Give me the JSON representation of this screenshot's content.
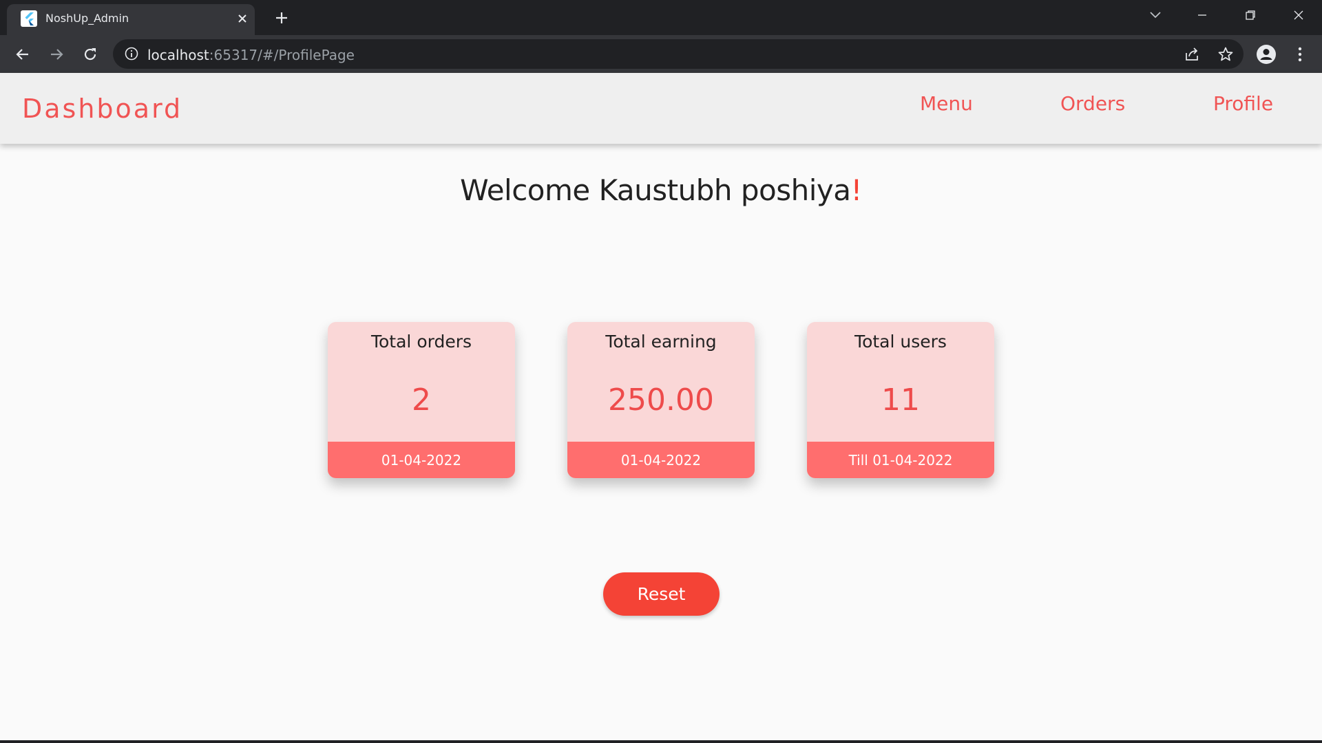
{
  "browser": {
    "tab_title": "NoshUp_Admin",
    "url_host": "localhost",
    "url_path": ":65317/#/ProfilePage"
  },
  "app": {
    "brand": "Dashboard",
    "nav": {
      "menu": "Menu",
      "orders": "Orders",
      "profile": "Profile"
    },
    "welcome_text": "Welcome Kaustubh poshiya",
    "welcome_suffix": "!",
    "cards": [
      {
        "title": "Total orders",
        "value": "2",
        "footer": "01-04-2022"
      },
      {
        "title": "Total earning",
        "value": "250.00",
        "footer": "01-04-2022"
      },
      {
        "title": "Total users",
        "value": "11",
        "footer": "Till 01-04-2022"
      }
    ],
    "reset_label": "Reset"
  },
  "colors": {
    "accent": "#f05454",
    "card_bg": "#fad7d7",
    "card_footer": "#ff6e6e",
    "button": "#f44336"
  },
  "icons": [
    "flutter-favicon-icon",
    "close-icon",
    "plus-icon",
    "chevron-down-icon",
    "minimize-icon",
    "restore-icon",
    "window-close-icon",
    "back-arrow-icon",
    "forward-arrow-icon",
    "reload-icon",
    "info-icon",
    "share-icon",
    "star-icon",
    "profile-icon",
    "kebab-menu-icon"
  ]
}
